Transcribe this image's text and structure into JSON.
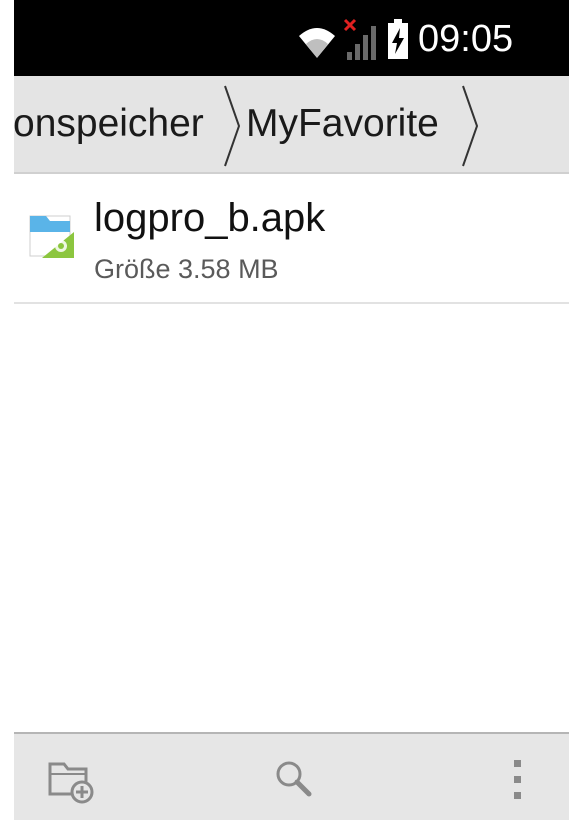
{
  "status_bar": {
    "time": "09:05",
    "wifi_icon": "wifi-icon",
    "signal_icon": "no-signal-icon",
    "battery_icon": "battery-charging-icon"
  },
  "breadcrumb": {
    "items": [
      {
        "label": "onspeicher"
      },
      {
        "label": "MyFavorite"
      }
    ],
    "separator_icon": "chevron-right-icon"
  },
  "files": [
    {
      "name": "logpro_b.apk",
      "size": "Größe 3.58 MB",
      "icon": "apk-file-icon"
    }
  ],
  "bottom_bar": {
    "actions": [
      {
        "icon": "new-folder-icon"
      },
      {
        "icon": "search-icon"
      },
      {
        "icon": "overflow-menu-icon"
      }
    ]
  },
  "colors": {
    "status_bar_bg": "#000000",
    "breadcrumb_bg": "#e4e4e4",
    "bottom_bar_bg": "#e6e6e6",
    "apk_green": "#8cc63f",
    "folder_blue": "#5ab4e8"
  }
}
